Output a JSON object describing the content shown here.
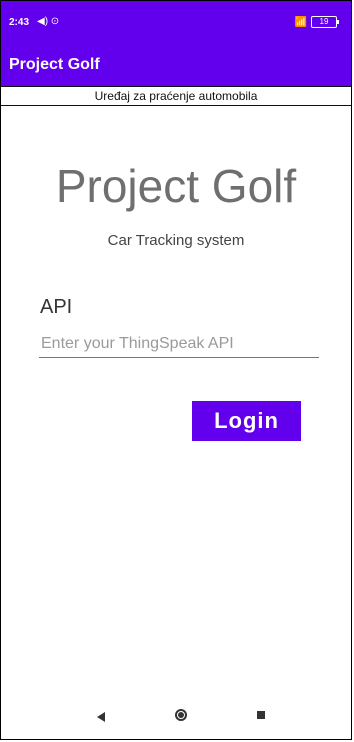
{
  "status_bar": {
    "time": "2:43",
    "left_icons": "◀) ⊙",
    "signal": "📶",
    "battery": "19"
  },
  "app_bar": {
    "title": "Project Golf"
  },
  "subtitle_strip": {
    "text": "Uređaj za praćenje automobila"
  },
  "hero": {
    "title": "Project Golf",
    "subtitle": "Car Tracking system"
  },
  "form": {
    "api_label": "API",
    "api_placeholder": "Enter your ThingSpeak API",
    "login_label": "Login"
  },
  "colors": {
    "primary": "#6200ee"
  },
  "icons": [
    "back-icon",
    "home-icon",
    "recent-apps-icon"
  ]
}
